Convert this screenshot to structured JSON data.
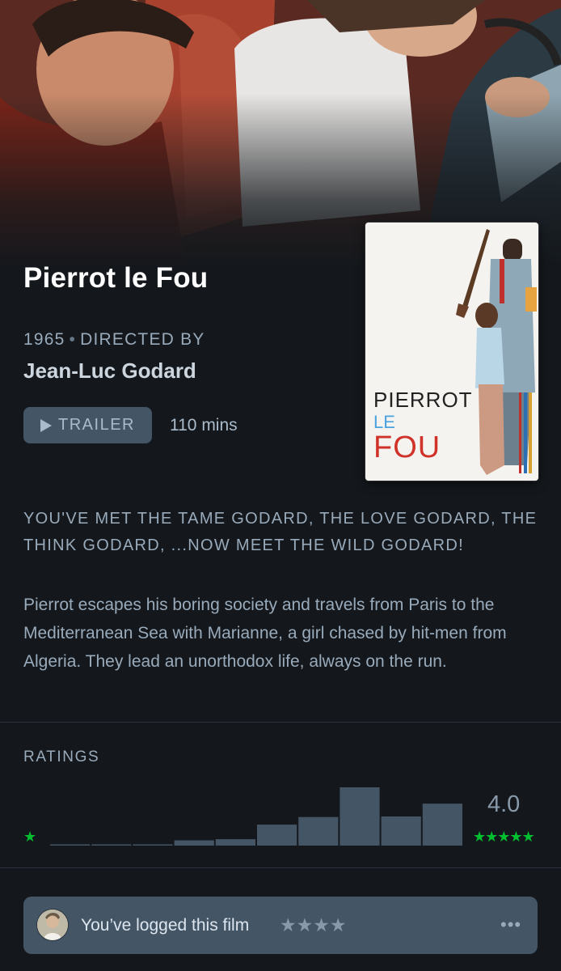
{
  "film": {
    "title": "Pierrot le Fou",
    "year": "1965",
    "separator": "•",
    "directed_by_label": "DIRECTED BY",
    "director": "Jean-Luc Godard",
    "trailer_label": "TRAILER",
    "runtime": "110 mins",
    "tagline": "YOU'VE MET THE TAME GODARD, THE LOVE GODARD, THE THINK GODARD, ...NOW MEET THE WILD GODARD!",
    "synopsis": "Pierrot escapes his boring society and travels from Paris to the Mediterranean Sea with Marianne, a girl chased by hit-men from Algeria. They lead an unorthodox life, always on the run."
  },
  "poster": {
    "line1": "PIERROT",
    "line2": "LE",
    "line3": "FOU",
    "colors": {
      "line1": "#222222",
      "line2": "#4aa3e0",
      "line3": "#d0322a"
    }
  },
  "ratings": {
    "label": "RATINGS",
    "average": "4.0",
    "low_star": "★",
    "high_stars": "★★★★★",
    "star_color": "#00c030",
    "bar_color": "#445566",
    "histogram_relative_heights": [
      0.02,
      0.02,
      0.02,
      0.09,
      0.11,
      0.36,
      0.49,
      1.0,
      0.5,
      0.72
    ]
  },
  "log": {
    "text": "You’ve logged this film",
    "stars": "★★★★",
    "more_icon": "•••"
  },
  "colors": {
    "background": "#14181c",
    "muted_text": "#99aabb",
    "card": "#445566"
  }
}
